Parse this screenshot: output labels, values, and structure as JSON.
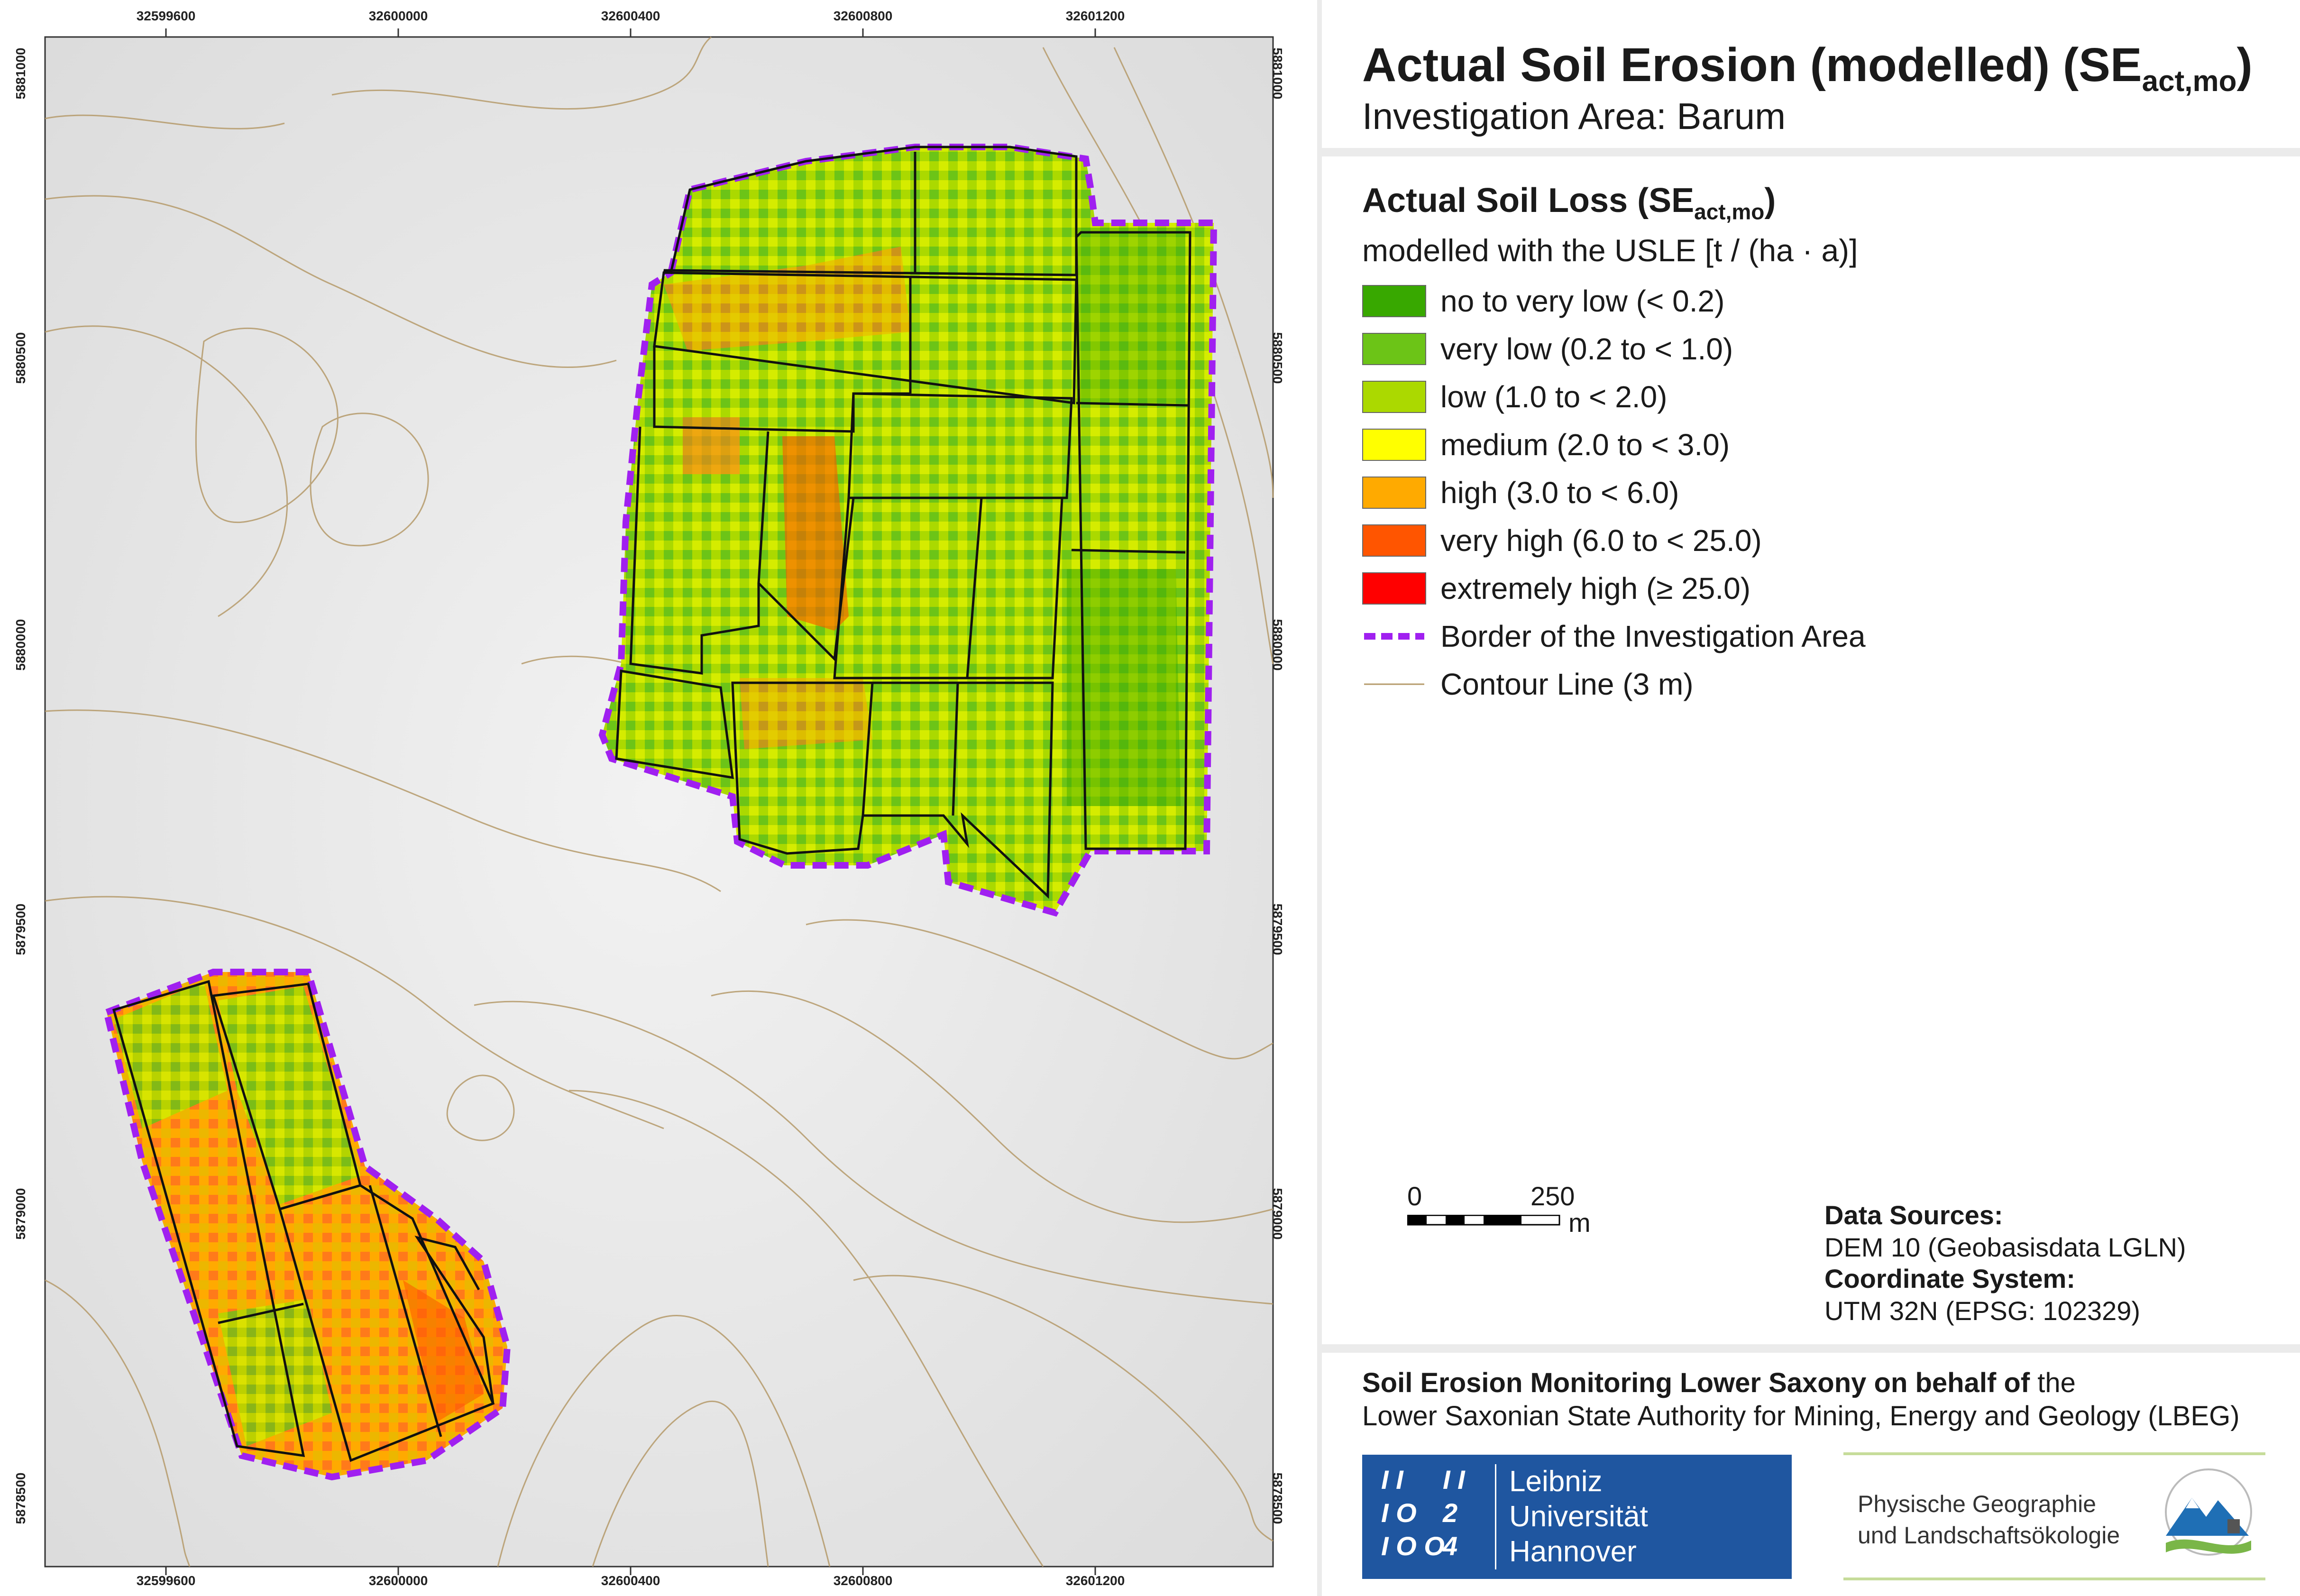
{
  "header": {
    "title_main": "Actual Soil Erosion (modelled) (SE",
    "title_sub": "act,mo",
    "title_end": ")",
    "subtitle": "Investigation Area: Barum"
  },
  "legend": {
    "title_main": "Actual Soil Loss (SE",
    "title_sub": "act,mo",
    "title_end": ")",
    "subtitle": "modelled with the USLE [t / (ha · a)]",
    "classes": [
      {
        "label": "no to very low (< 0.2)",
        "color": "#38a800"
      },
      {
        "label": "very low (0.2 to < 1.0)",
        "color": "#6cc417"
      },
      {
        "label": "low (1.0 to < 2.0)",
        "color": "#abd900"
      },
      {
        "label": "medium (2.0 to < 3.0)",
        "color": "#ffff00"
      },
      {
        "label": "high (3.0 to < 6.0)",
        "color": "#ffaa00"
      },
      {
        "label": "very high (6.0 to < 25.0)",
        "color": "#ff5500"
      },
      {
        "label": "extremely high (≥ 25.0)",
        "color": "#ff0000"
      }
    ],
    "border_label": "Border of the Investigation Area",
    "border_color": "#a020f0",
    "contour_label": "Contour Line (3 m)",
    "contour_color": "#b59a6a"
  },
  "map": {
    "ticks_x": [
      "32599600",
      "32600000",
      "32600400",
      "32600800",
      "32601200"
    ],
    "ticks_y": [
      "5881000",
      "5880500",
      "5880000",
      "5879500",
      "5879000",
      "5878500"
    ]
  },
  "scalebar": {
    "start": "0",
    "end": "250",
    "unit": "m"
  },
  "sources": {
    "data_heading": "Data Sources:",
    "data_value": "DEM 10 (Geobasisdata LGLN)",
    "crs_heading": "Coordinate System:",
    "crs_value": "UTM 32N (EPSG: 102329)"
  },
  "credits": {
    "line1_bold": "Soil Erosion Monitoring Lower Saxony on behalf of",
    "line1_rest": " the",
    "line2": "Lower Saxonian State Authority for Mining, Energy and Geology (LBEG)",
    "luh_lines": [
      "Leibniz",
      "Universität",
      "Hannover"
    ],
    "pgl_lines": [
      "Physische Geographie",
      "und Landschaftsökologie"
    ]
  }
}
